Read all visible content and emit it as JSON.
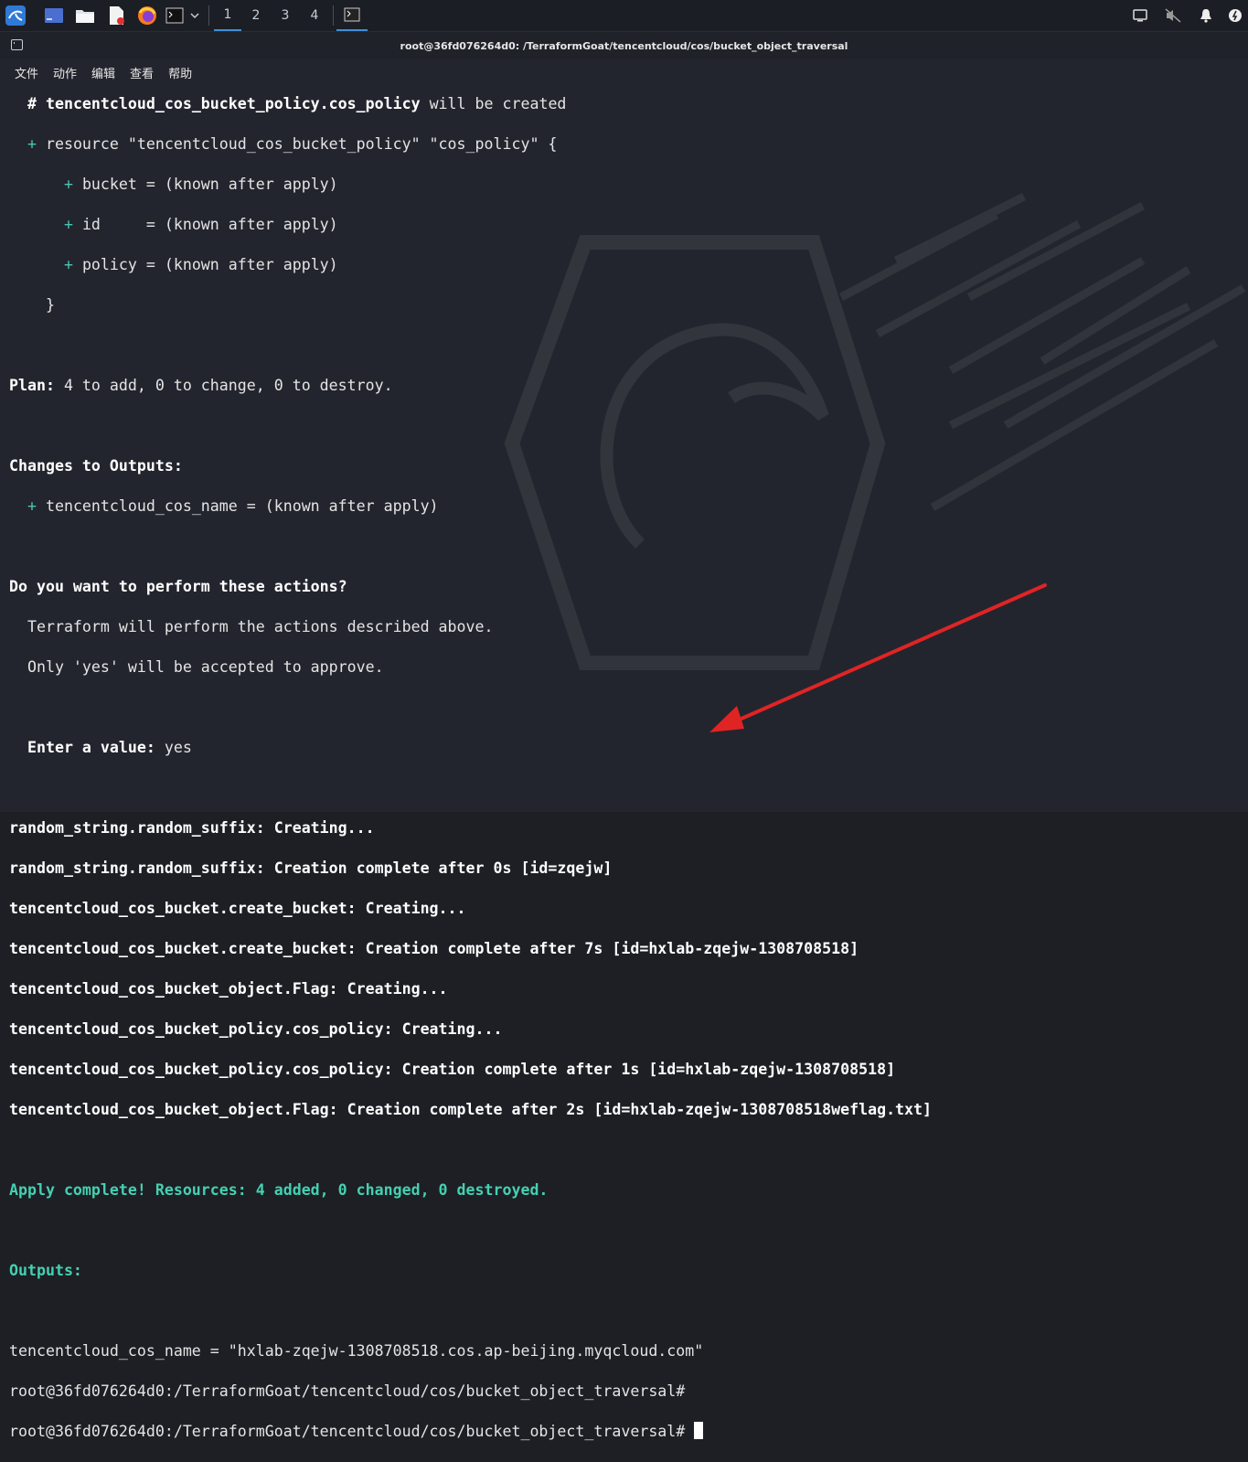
{
  "taskbar": {
    "workspaces": [
      "1",
      "2",
      "3",
      "4"
    ],
    "active_workspace": "1"
  },
  "window": {
    "title": "root@36fd076264d0: /TerraformGoat/tencentcloud/cos/bucket_object_traversal",
    "menu": [
      "文件",
      "动作",
      "编辑",
      "查看",
      "帮助"
    ]
  },
  "terminal": {
    "l01_hash": "  # ",
    "l01_name": "tencentcloud_cos_bucket_policy.cos_policy",
    "l01_rest": " will be created",
    "l02_plus": "  + ",
    "l02_rest": "resource \"tencentcloud_cos_bucket_policy\" \"cos_policy\" {",
    "l03_plus": "      + ",
    "l03_rest": "bucket = (known after apply)",
    "l04_plus": "      + ",
    "l04_rest": "id     = (known after apply)",
    "l05_plus": "      + ",
    "l05_rest": "policy = (known after apply)",
    "l06": "    }",
    "l08_label": "Plan:",
    "l08_rest": " 4 to add, 0 to change, 0 to destroy.",
    "l10": "Changes to Outputs:",
    "l11_plus": "  + ",
    "l11_rest": "tencentcloud_cos_name = (known after apply)",
    "l13": "Do you want to perform these actions?",
    "l14": "  Terraform will perform the actions described above.",
    "l15": "  Only 'yes' will be accepted to approve.",
    "l17_label": "  Enter a value:",
    "l17_value": " yes",
    "l19": "random_string.random_suffix: Creating...",
    "l20": "random_string.random_suffix: Creation complete after 0s [id=zqejw]",
    "l21": "tencentcloud_cos_bucket.create_bucket: Creating...",
    "l22": "tencentcloud_cos_bucket.create_bucket: Creation complete after 7s [id=hxlab-zqejw-1308708518]",
    "l23": "tencentcloud_cos_bucket_object.Flag: Creating...",
    "l24": "tencentcloud_cos_bucket_policy.cos_policy: Creating...",
    "l25": "tencentcloud_cos_bucket_policy.cos_policy: Creation complete after 1s [id=hxlab-zqejw-1308708518]",
    "l26": "tencentcloud_cos_bucket_object.Flag: Creation complete after 2s [id=hxlab-zqejw-1308708518weflag.txt]",
    "l28": "Apply complete! Resources: 4 added, 0 changed, 0 destroyed.",
    "l30": "Outputs:",
    "l32": "tencentcloud_cos_name = \"hxlab-zqejw-1308708518.cos.ap-beijing.myqcloud.com\"",
    "l33": "root@36fd076264d0:/TerraformGoat/tencentcloud/cos/bucket_object_traversal#",
    "l34": "root@36fd076264d0:/TerraformGoat/tencentcloud/cos/bucket_object_traversal# "
  },
  "colors": {
    "terminal_bg": "#23252e",
    "plus_accent": "#49c6b5",
    "success_green": "#45d0b0",
    "arrow_red": "#e02424"
  }
}
